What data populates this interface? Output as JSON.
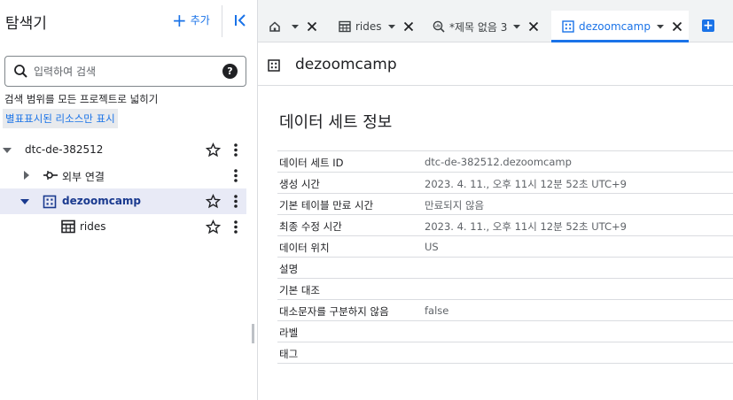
{
  "explorer": {
    "title": "탐색기",
    "add_label": "추가",
    "search": {
      "placeholder": "입력하여 검색"
    },
    "scope_text": "검색 범위를 모든 프로젝트로 넓히기",
    "starred_link": "별표표시된 리소스만 표시",
    "tree": [
      {
        "label": "dtc-de-382512",
        "type": "project",
        "icon": "none",
        "expanded": true
      },
      {
        "label": "외부 연결",
        "type": "connections",
        "icon": "connection-icon",
        "expanded": false
      },
      {
        "label": "dezoomcamp",
        "type": "dataset",
        "icon": "dataset-icon",
        "expanded": true,
        "selected": true
      },
      {
        "label": "rides",
        "type": "table",
        "icon": "table-icon"
      }
    ]
  },
  "tabs": [
    {
      "label": "",
      "icon": "home-icon",
      "active": false
    },
    {
      "label": "rides",
      "icon": "table-icon",
      "active": false
    },
    {
      "label": "*제목 없음 3",
      "icon": "query-icon",
      "active": false
    },
    {
      "label": "dezoomcamp",
      "icon": "dataset-icon",
      "active": true
    }
  ],
  "dataset_header": {
    "title": "dezoomcamp"
  },
  "info": {
    "title": "데이터 세트 정보",
    "rows": [
      {
        "key": "데이터 세트 ID",
        "value": "dtc-de-382512.dezoomcamp"
      },
      {
        "key": "생성 시간",
        "value": "2023. 4. 11., 오후 11시 12분 52초 UTC+9"
      },
      {
        "key": "기본 테이블 만료 시간",
        "value": "만료되지 않음"
      },
      {
        "key": "최종 수정 시간",
        "value": "2023. 4. 11., 오후 11시 12분 52초 UTC+9"
      },
      {
        "key": "데이터 위치",
        "value": "US"
      },
      {
        "key": "설명",
        "value": ""
      },
      {
        "key": "기본 대조",
        "value": ""
      },
      {
        "key": "대소문자를 구분하지 않음",
        "value": "false"
      },
      {
        "key": "라벨",
        "value": ""
      },
      {
        "key": "태그",
        "value": ""
      }
    ]
  },
  "colors": {
    "accent": "#1a73e8",
    "selected_row": "#e8eaf6",
    "text": "#202124",
    "muted": "#5f6368"
  }
}
